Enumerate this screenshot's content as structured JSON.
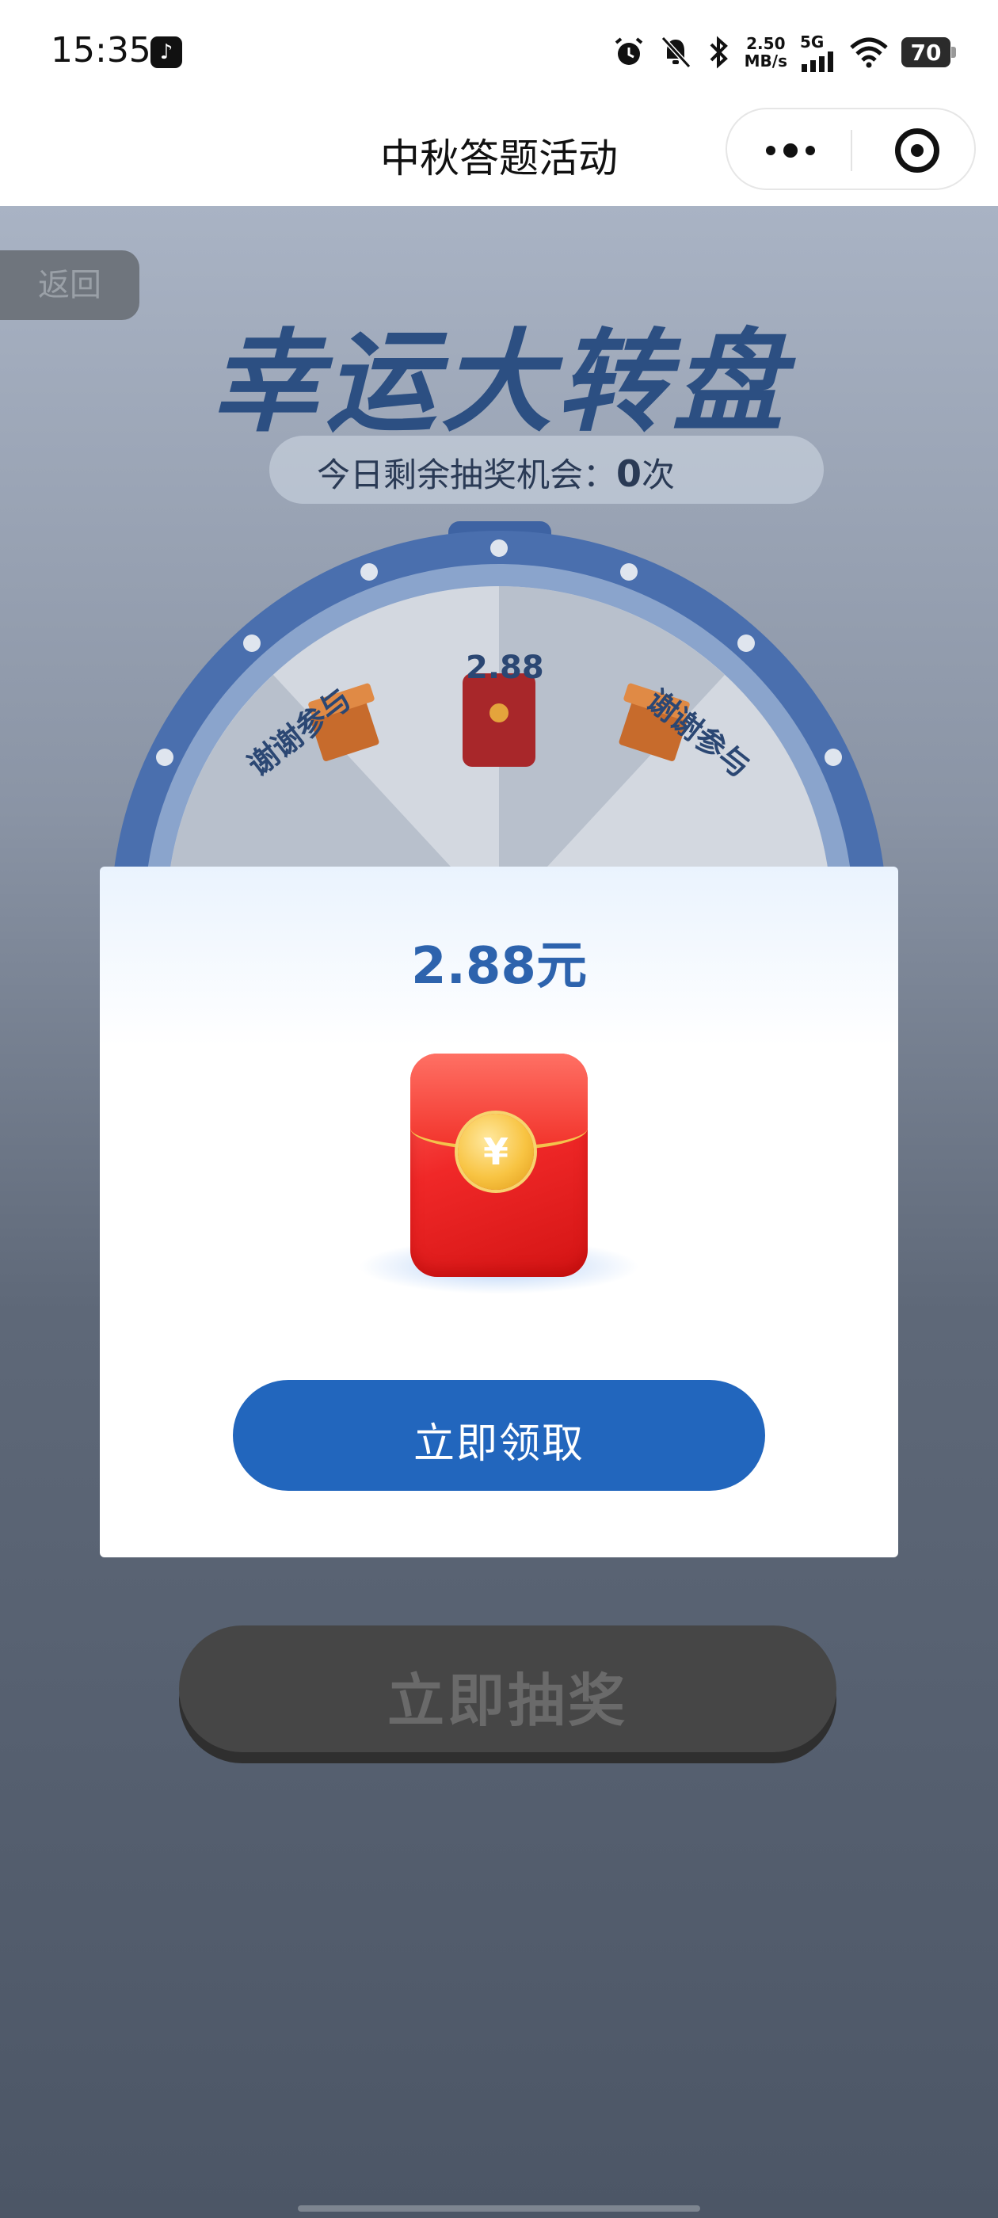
{
  "status_bar": {
    "time": "15:35",
    "net_speed_value": "2.50",
    "net_speed_unit": "MB/s",
    "network": "5G",
    "battery": "70",
    "icons": [
      "tiktok-icon",
      "alarm-icon",
      "mute-bell-icon",
      "bluetooth-icon",
      "signal-icon",
      "wifi-icon",
      "battery-icon"
    ]
  },
  "nav": {
    "title": "中秋答题活动"
  },
  "page": {
    "back_label": "返回",
    "title": "幸运大转盘",
    "chance_prefix": "今日剩余抽奖机会：",
    "chance_count": "0",
    "chance_suffix": "次",
    "wheel": {
      "segments": [
        {
          "label": "谢谢参与"
        },
        {
          "label": "2.88"
        },
        {
          "label": "谢谢参与"
        }
      ]
    },
    "draw_button": "立即抽奖"
  },
  "modal": {
    "amount": "2.88元",
    "coin_symbol": "¥",
    "claim_button": "立即领取"
  },
  "colors": {
    "primary_blue": "#2266bd",
    "amount_blue": "#2d63ad",
    "envelope_red": "#f02828",
    "coin_gold": "#f8c443"
  }
}
